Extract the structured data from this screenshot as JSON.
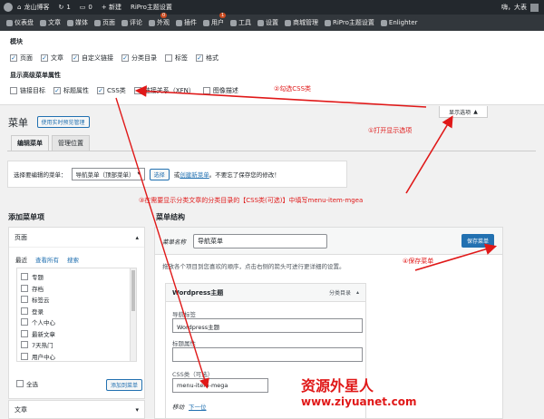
{
  "topbar": {
    "site": "龙山博客",
    "updates": "1",
    "comments": "0",
    "new": "+ 新建",
    "theme": "RiPro主题设置",
    "greeting": "嗨，大表"
  },
  "menubar": [
    {
      "label": "仪表盘",
      "icon": "dashboard-icon"
    },
    {
      "label": "文章",
      "icon": "pin-icon"
    },
    {
      "label": "媒体",
      "icon": "media-icon"
    },
    {
      "label": "页面",
      "icon": "page-icon"
    },
    {
      "label": "评论",
      "icon": "comment-icon",
      "badge": "0"
    },
    {
      "label": "外观",
      "icon": "appearance-icon"
    },
    {
      "label": "插件",
      "icon": "plugin-icon",
      "badge": "1"
    },
    {
      "label": "用户",
      "icon": "user-icon"
    },
    {
      "label": "工具",
      "icon": "tool-icon"
    },
    {
      "label": "设置",
      "icon": "settings-icon"
    },
    {
      "label": "商城管理",
      "icon": "shop-icon"
    },
    {
      "label": "RiPro主题设置",
      "icon": "gear-icon"
    },
    {
      "label": "Enlighter",
      "icon": "code-icon"
    }
  ],
  "screen_options": {
    "boxes_heading": "模块",
    "boxes": [
      {
        "label": "页面",
        "checked": true
      },
      {
        "label": "文章",
        "checked": true
      },
      {
        "label": "自定义链接",
        "checked": true
      },
      {
        "label": "分类目录",
        "checked": true
      },
      {
        "label": "标签",
        "checked": false
      },
      {
        "label": "格式",
        "checked": true
      }
    ],
    "advanced_heading": "显示高级菜单属性",
    "advanced": [
      {
        "label": "链接目标",
        "checked": false
      },
      {
        "label": "标题属性",
        "checked": true
      },
      {
        "label": "CSS类",
        "checked": true
      },
      {
        "label": "链接关系（XFN）",
        "checked": false
      },
      {
        "label": "图像描述",
        "checked": false
      }
    ],
    "toggle_label": "显示选项"
  },
  "page": {
    "title": "菜单",
    "live_button": "使用实时预览管理",
    "tabs": [
      {
        "label": "编辑菜单",
        "active": true
      },
      {
        "label": "管理位置",
        "active": false
      }
    ],
    "select_label": "选择要编辑的菜单：",
    "select_value": "导航菜单（顶部菜单）",
    "select_button": "选择",
    "or_text": "或",
    "create_link": "创建新菜单",
    "reminder": "。不要忘了保存您的修改！"
  },
  "add_items": {
    "heading": "添加菜单项",
    "pages_title": "页面",
    "subtabs": [
      "最近",
      "查看所有",
      "搜索"
    ],
    "pages": [
      "专题",
      "存档",
      "标签云",
      "登录",
      "个人中心",
      "最新文章",
      "7天热门",
      "用户中心"
    ],
    "select_all": "全选",
    "add_button": "添加到菜单",
    "articles_title": "文章"
  },
  "structure": {
    "heading": "菜单结构",
    "name_label": "菜单名称",
    "name_value": "导航菜单",
    "save_button": "保存菜单",
    "description": "拖放各个项目到您喜欢的顺序，点击右侧的箭头可进行更详细的设置。",
    "item": {
      "title": "Wordpress主题",
      "type": "分类目录",
      "nav_label_label": "导航标签",
      "nav_label_value": "Wordpress主题",
      "title_attr_label": "标题属性",
      "title_attr_value": "",
      "css_label": "CSS类（可选）",
      "css_value": "menu-item-mega",
      "move_label": "移动",
      "move_link": "下一位"
    }
  },
  "annotations": {
    "a1": "①打开显示选项",
    "a2": "②勾选CSS类",
    "a3": "③在需要显示分类文章的分类目录的【CSS类(可选)】中填写menu-item-mgea",
    "a4": "④保存菜单",
    "color": "#e01818"
  },
  "watermark": {
    "name": "资源外星人",
    "url": "www.ziyuanet.com"
  }
}
